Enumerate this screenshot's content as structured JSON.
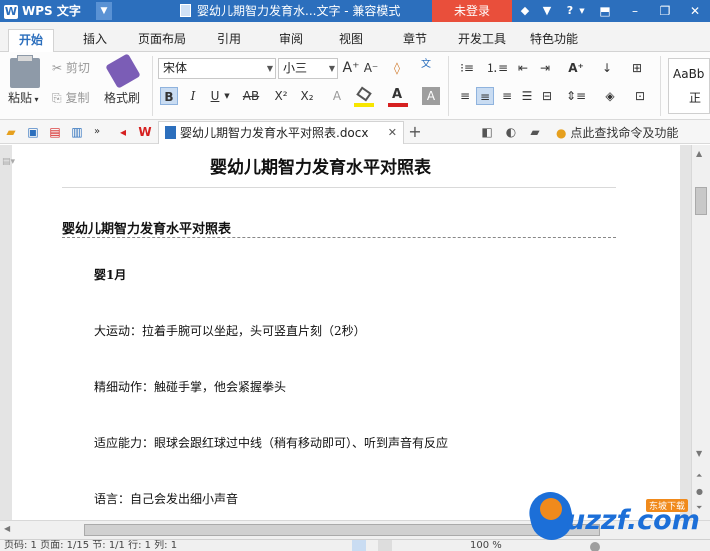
{
  "app": {
    "logo_text": "WPS 文字",
    "window_title": "婴幼儿期智力发育水...文字 - 兼容模式",
    "login_label": "未登录",
    "help_label": "?"
  },
  "ribbon_tabs": [
    "开始",
    "插入",
    "页面布局",
    "引用",
    "审阅",
    "视图",
    "章节",
    "开发工具",
    "特色功能"
  ],
  "clipboard": {
    "paste": "粘贴",
    "cut": "剪切",
    "copy": "复制",
    "format_painter": "格式刷"
  },
  "font": {
    "name": "宋体",
    "size": "小三"
  },
  "styles_preview": {
    "sample": "AaBb",
    "name": "正"
  },
  "document_tab": {
    "filename": "婴幼儿期智力发育水平对照表.docx"
  },
  "tip": "点此查找命令及功能",
  "document": {
    "title": "婴幼儿期智力发育水平对照表",
    "subtitle": "婴幼儿期智力发育水平对照表",
    "section_heading": "婴1月",
    "paragraphs": [
      "大运动：拉着手腕可以坐起，头可竖直片刻（2秒）",
      "精细动作：触碰手掌，他会紧握拳头",
      "适应能力：眼球会跟红球过中线（稍有移动即可）、听到声音有反应",
      "语言：自己会发出细小声音"
    ]
  },
  "status": {
    "text": "页码: 1   页面: 1/15   节: 1/1   行: 1   列: 1",
    "zoom": "100 %"
  },
  "watermark": {
    "brand": "uzzf.com",
    "tag": "东坡下载"
  },
  "colors": {
    "title_bar": "#2c6fbd",
    "login_button": "#e94f3b",
    "watermark_blue": "#1c6fd8",
    "watermark_orange": "#f08a1c"
  }
}
